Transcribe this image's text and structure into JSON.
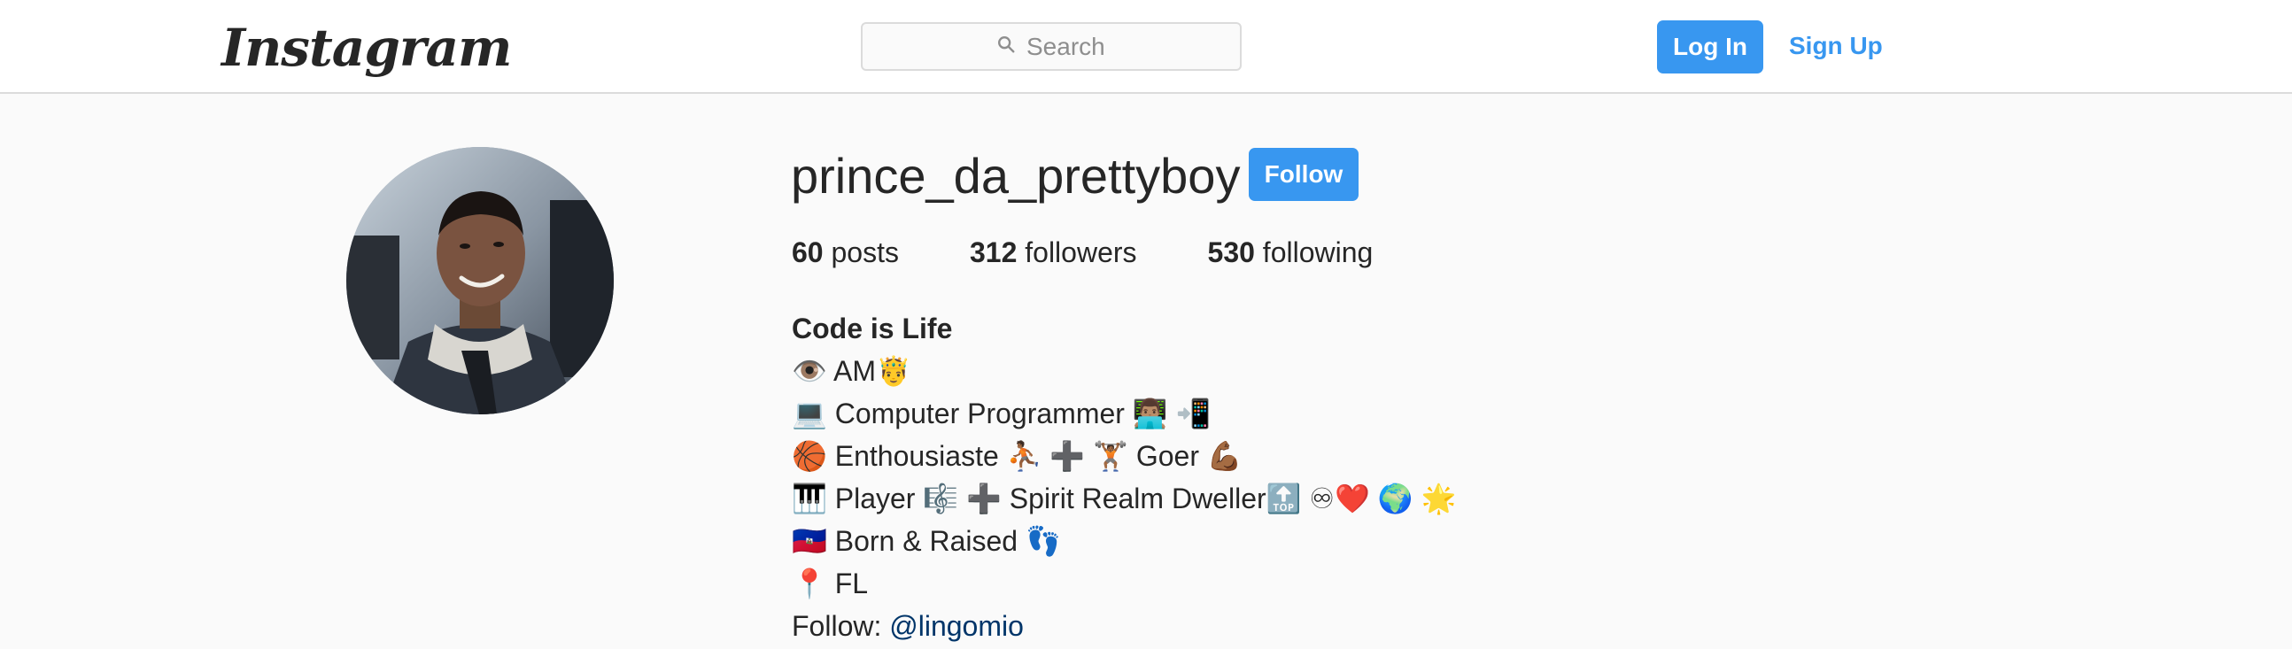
{
  "header": {
    "logo": "Instagram",
    "search_placeholder": "Search",
    "login_label": "Log In",
    "signup_label": "Sign Up"
  },
  "profile": {
    "username": "prince_da_prettyboy",
    "follow_label": "Follow",
    "stats": {
      "posts_count": "60",
      "posts_label": "posts",
      "followers_count": "312",
      "followers_label": "followers",
      "following_count": "530",
      "following_label": "following"
    },
    "bio": {
      "name": "Code is Life",
      "lines": [
        "👁️  AM🤴",
        "💻  Computer Programmer 👨🏽‍💻 📲",
        "🏀  Enthousiaste ⛹🏾 ➕ 🏋🏾  Goer 💪🏾",
        "🎹  Player 🎼 ➕ Spirit Realm Dweller🔝 ♾❤️ 🌍 🌟",
        "🇭🇹  Born & Raised 👣",
        "📍 FL"
      ],
      "follow_prefix": "Follow: ",
      "mention": "@lingomio"
    }
  },
  "colors": {
    "accent": "#3897f0",
    "background": "#fafafa",
    "text": "#262626",
    "mention": "#003569",
    "border": "#dbdbdb"
  },
  "icons": {
    "search": "search-icon",
    "avatar": "profile-photo"
  }
}
